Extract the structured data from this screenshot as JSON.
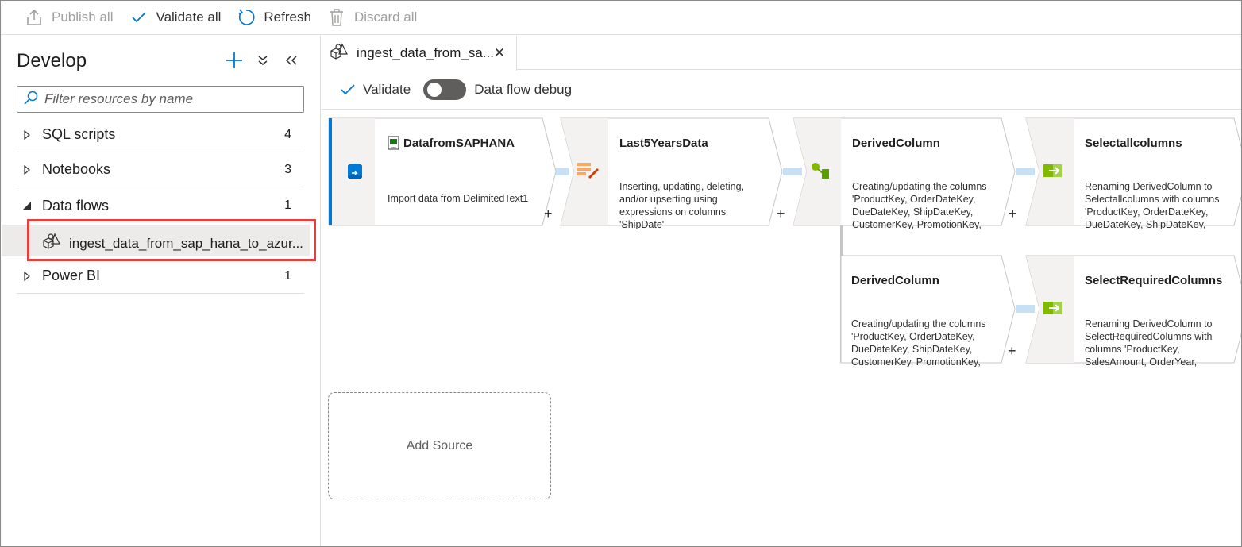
{
  "toolbar": {
    "publish_all": "Publish all",
    "validate_all": "Validate all",
    "refresh": "Refresh",
    "discard_all": "Discard all"
  },
  "sidebar": {
    "title": "Develop",
    "filter_placeholder": "Filter resources by name",
    "groups": [
      {
        "label": "SQL scripts",
        "count": "4"
      },
      {
        "label": "Notebooks",
        "count": "3"
      },
      {
        "label": "Data flows",
        "count": "1"
      },
      {
        "label": "Power BI",
        "count": "1"
      }
    ],
    "dataflow_item": "ingest_data_from_sap_hana_to_azur..."
  },
  "tab": {
    "label": "ingest_data_from_sa..."
  },
  "subtoolbar": {
    "validate": "Validate",
    "debug": "Data flow debug",
    "debug_on": false
  },
  "flow": {
    "nodes": [
      {
        "title": "DatafromSAPHANA",
        "desc": "Import data from DelimitedText1"
      },
      {
        "title": "Last5YearsData",
        "desc": "Inserting, updating, deleting, and/or upserting using expressions on columns 'ShipDate'"
      },
      {
        "title": "DerivedColumn",
        "desc": "Creating/updating the columns 'ProductKey, OrderDateKey, DueDateKey, ShipDateKey, CustomerKey, PromotionKey, CurrencyKey"
      },
      {
        "title": "Selectallcolumns",
        "desc": "Renaming DerivedColumn to Selectallcolumns with columns 'ProductKey, OrderDateKey, DueDateKey, ShipDateKey, CustomerKey, PromotionKey"
      },
      {
        "title": "DerivedColumn",
        "desc": "Creating/updating the columns 'ProductKey, OrderDateKey, DueDateKey, ShipDateKey, CustomerKey, PromotionKey, CurrencyKey"
      },
      {
        "title": "SelectRequiredColumns",
        "desc": "Renaming DerivedColumn to SelectRequiredColumns with columns 'ProductKey, SalesAmount, OrderYear, OrderMonth, OrderDate"
      }
    ],
    "plus": "+",
    "add_source": "Add Source"
  },
  "colors": {
    "accent": "#0078d4",
    "highlight": "#e0413f",
    "connector": "#c7e0f4"
  }
}
